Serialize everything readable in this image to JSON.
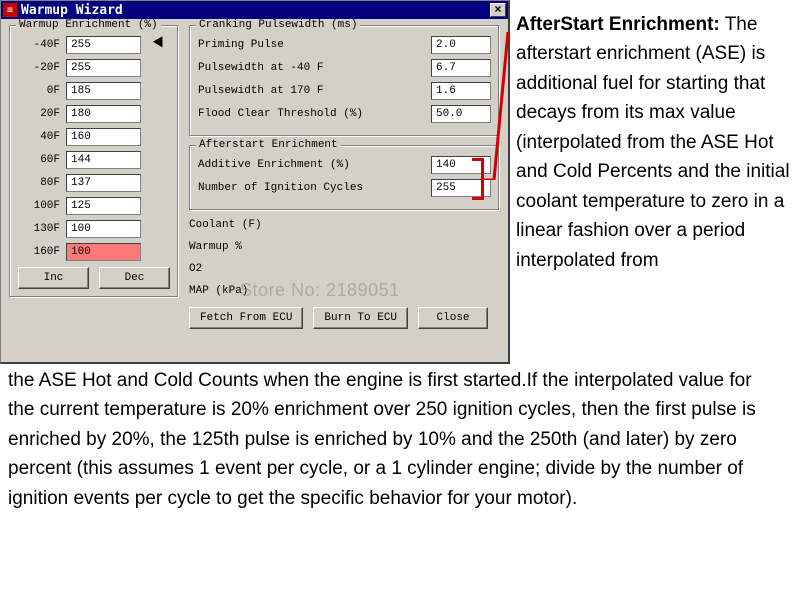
{
  "window": {
    "title": "Warmup Wizard",
    "sysicon_label": "≡",
    "close_label": "×"
  },
  "warmup": {
    "legend": "Warmup Enrichment (%)",
    "rows": [
      {
        "temp": "-40F",
        "value": "255",
        "pointer": true
      },
      {
        "temp": "-20F",
        "value": "255"
      },
      {
        "temp": "0F",
        "value": "185"
      },
      {
        "temp": "20F",
        "value": "180"
      },
      {
        "temp": "40F",
        "value": "160"
      },
      {
        "temp": "60F",
        "value": "144"
      },
      {
        "temp": "80F",
        "value": "137"
      },
      {
        "temp": "100F",
        "value": "125"
      },
      {
        "temp": "130F",
        "value": "100"
      },
      {
        "temp": "160F",
        "value": "100",
        "selected": true
      }
    ],
    "inc_label": "Inc",
    "dec_label": "Dec"
  },
  "cranking": {
    "legend": "Cranking Pulsewidth (ms)",
    "rows": [
      {
        "label": "Priming Pulse",
        "value": "2.0"
      },
      {
        "label": "Pulsewidth at -40 F",
        "value": "6.7"
      },
      {
        "label": "Pulsewidth at  170 F",
        "value": "1.6"
      },
      {
        "label": "Flood Clear Threshold (%)",
        "value": "50.0"
      }
    ]
  },
  "ase": {
    "legend": "Afterstart Enrichment",
    "rows": [
      {
        "label": "Additive Enrichment (%)",
        "value": "140"
      },
      {
        "label": "Number of Ignition Cycles",
        "value": "255"
      }
    ]
  },
  "status": {
    "rows": [
      {
        "label": "Coolant (F)"
      },
      {
        "label": "Warmup %"
      },
      {
        "label": "O2"
      },
      {
        "label": "MAP (kPa)"
      }
    ]
  },
  "footer": {
    "fetch": "Fetch From ECU",
    "burn": "Burn To ECU",
    "close": "Close"
  },
  "explain": {
    "heading": "AfterStart Enrichment:",
    "para_right": "The afterstart enrichment (ASE) is additional fuel for starting that decays from its max value (interpolated from the ASE Hot and Cold Percents and the initial coolant temperature to zero in a linear fashion over a period interpolated from",
    "para_bottom": "the ASE Hot and Cold Counts when the engine is first started.If the interpolated value for the current temperature is 20% enrichment over 250 ignition cycles, then the first pulse is enriched by 20%, the 125th pulse is enriched by 10% and the 250th (and later) by zero percent (this assumes 1 event per cycle, or a 1 cylinder engine; divide by the number of ignition events per cycle to get the specific behavior for your motor)."
  },
  "watermark": "Store No: 2189051"
}
